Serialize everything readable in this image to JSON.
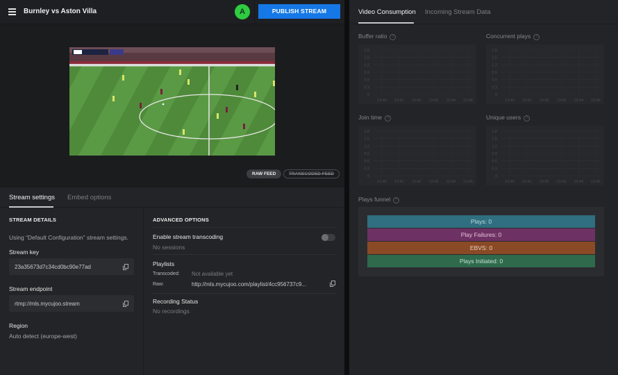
{
  "header": {
    "title": "Burnley vs Aston Villa",
    "avatar_letter": "A",
    "publish_label": "PUBLISH STREAM"
  },
  "feeds": {
    "raw": "RAW FEED",
    "transcoded": "TRANSCODED FEED"
  },
  "tabs": {
    "stream_settings": "Stream settings",
    "embed_options": "Embed options"
  },
  "stream_details": {
    "title": "STREAM DETAILS",
    "using_text": "Using “Default Configuration” stream settings.",
    "stream_key_label": "Stream key",
    "stream_key_value": "23a35673d7c34cd0bc90e77ad",
    "endpoint_label": "Stream endpoint",
    "endpoint_value": "rtmp://mls.mycujoo.stream",
    "region_label": "Region",
    "region_value": "Auto detect (europe-west)"
  },
  "advanced": {
    "title": "ADVANCED OPTIONS",
    "transcoding_label": "Enable stream transcoding",
    "transcoding_enabled": false,
    "sessions_text": "No sessions",
    "playlists_label": "Playlists",
    "transcoded_label": "Transcoded:",
    "transcoded_value": "Not available yet",
    "raw_label": "Raw:",
    "raw_value": "http://mls.mycujoo.com/playlist/4cc956737c9...",
    "recording_label": "Recording Status",
    "recording_value": "No recordings"
  },
  "right_tabs": {
    "video_consumption": "Video Consumption",
    "incoming": "Incoming Stream Data"
  },
  "charts_meta": {
    "help_icon": "?"
  },
  "chart_data": [
    {
      "type": "line",
      "title": "Buffer ratio",
      "x": [
        "13:40",
        "13:41",
        "13:42",
        "13:43",
        "13:44",
        "13:45"
      ],
      "y_ticks": [
        "1.8",
        "1.5",
        "1.2",
        "0.9",
        "0.6",
        "0.3",
        "0"
      ],
      "series": []
    },
    {
      "type": "line",
      "title": "Concurrent plays",
      "x": [
        "13:40",
        "13:41",
        "13:42",
        "13:43",
        "13:44",
        "13:45"
      ],
      "y_ticks": [
        "1.8",
        "1.5",
        "1.2",
        "0.9",
        "0.6",
        "0.3",
        "0"
      ],
      "series": []
    },
    {
      "type": "line",
      "title": "Join time",
      "x": [
        "13:40",
        "13:41",
        "13:42",
        "13:43",
        "13:44",
        "13:45"
      ],
      "y_ticks": [
        "1.8",
        "1.5",
        "1.2",
        "0.9",
        "0.6",
        "0.3",
        "0"
      ],
      "series": []
    },
    {
      "type": "line",
      "title": "Unique users",
      "x": [
        "13:40",
        "13:41",
        "13:42",
        "13:43",
        "13:44",
        "13:45"
      ],
      "y_ticks": [
        "1.8",
        "1.5",
        "1.2",
        "0.9",
        "0.6",
        "0.3",
        "0"
      ],
      "series": []
    }
  ],
  "funnel": {
    "title": "Plays funnel",
    "bars": [
      {
        "label": "Plays: 0",
        "color": "#2f6f80",
        "text": "#c6dbe2"
      },
      {
        "label": "Play Failures: 0",
        "color": "#6e3163",
        "text": "#e2c3db"
      },
      {
        "label": "EBVS: 0",
        "color": "#8a4a25",
        "text": "#ead2c3"
      },
      {
        "label": "Plays Initiated: 0",
        "color": "#2e6a4b",
        "text": "#c6e2d3"
      }
    ]
  }
}
